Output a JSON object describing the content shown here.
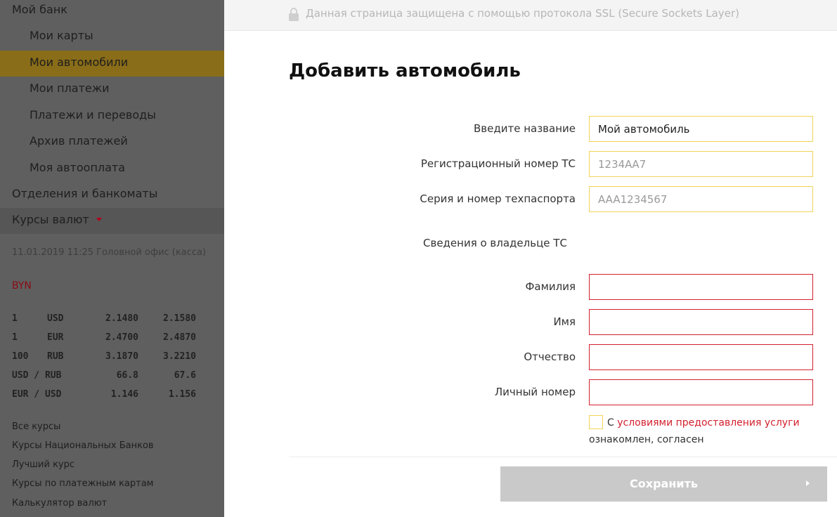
{
  "sidebar": {
    "menu": [
      {
        "label": "Мой банк"
      },
      {
        "label": "Мои карты"
      },
      {
        "label": "Мои автомобили"
      },
      {
        "label": "Мои платежи"
      },
      {
        "label": "Платежи и переводы"
      },
      {
        "label": "Архив платежей"
      },
      {
        "label": "Моя автооплата"
      },
      {
        "label": "Отделения и банкоматы"
      },
      {
        "label": "Курсы валют"
      }
    ],
    "rates": {
      "meta": "11.01.2019 11:25 Головной офис (касса)",
      "currency": "BYN",
      "rows": [
        {
          "amount": "1",
          "code": "USD",
          "buy": "2.1480",
          "sell": "2.1580"
        },
        {
          "amount": "1",
          "code": "EUR",
          "buy": "2.4700",
          "sell": "2.4870"
        },
        {
          "amount": "100",
          "code": "RUB",
          "buy": "3.1870",
          "sell": "3.2210"
        },
        {
          "amount": "USD / RUB",
          "code": "",
          "buy": "66.8",
          "sell": "67.6"
        },
        {
          "amount": "EUR / USD",
          "code": "",
          "buy": "1.146",
          "sell": "1.156"
        }
      ]
    },
    "links": [
      "Все курсы",
      "Курсы Национальных Банков",
      "Лучший курс",
      "Курсы по платежным картам",
      "Калькулятор валют"
    ]
  },
  "ssl": {
    "text": "Данная страница защищена с помощью протокола SSL (Secure Sockets Layer)"
  },
  "form": {
    "title": "Добавить автомобиль",
    "fields": [
      {
        "label": "Введите название",
        "value": "Мой автомобиль",
        "placeholder": ""
      },
      {
        "label": "Регистрационный номер ТС",
        "value": "",
        "placeholder": "1234АА7"
      },
      {
        "label": "Серия и номер техпаспорта",
        "value": "",
        "placeholder": "AAA1234567"
      }
    ],
    "owner_section": "Сведения о владельце ТС",
    "owner_fields": [
      {
        "label": "Фамилия",
        "value": ""
      },
      {
        "label": "Имя",
        "value": ""
      },
      {
        "label": "Отчество",
        "value": ""
      },
      {
        "label": "Личный номер",
        "value": ""
      }
    ],
    "agreement": {
      "prefix": "С",
      "link": "условиями предоставления услуги",
      "suffix": "ознакомлен, согласен"
    },
    "save_label": "Сохранить"
  },
  "colors": {
    "sidebar_bg": "#5f5f5f",
    "active_item": "#8a6d18",
    "input_border": "#f2d35a",
    "error_border": "#d3202d",
    "button_disabled": "#c9c9c9"
  }
}
